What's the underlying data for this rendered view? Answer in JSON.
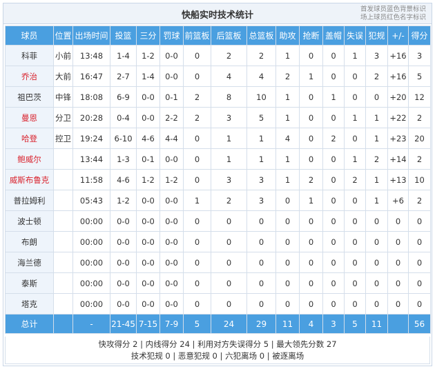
{
  "title": "快船实时技术统计",
  "legend": {
    "line1": "首发球员蓝色背景标识",
    "line2": "场上球员红色名字标识"
  },
  "headers": [
    "球员",
    "位置",
    "出场时间",
    "投篮",
    "三分",
    "罚球",
    "前篮板",
    "后篮板",
    "总篮板",
    "助攻",
    "抢断",
    "盖帽",
    "失误",
    "犯规",
    "+/-",
    "得分"
  ],
  "players": [
    {
      "name": "科菲",
      "on_court": false,
      "cells": [
        "小前",
        "13:48",
        "1-4",
        "1-2",
        "0-0",
        "0",
        "2",
        "2",
        "1",
        "0",
        "0",
        "1",
        "3",
        "+16",
        "3"
      ]
    },
    {
      "name": "乔治",
      "on_court": true,
      "cells": [
        "大前",
        "16:47",
        "2-7",
        "1-4",
        "0-0",
        "0",
        "4",
        "4",
        "2",
        "1",
        "0",
        "0",
        "2",
        "+16",
        "5"
      ]
    },
    {
      "name": "祖巴茨",
      "on_court": false,
      "cells": [
        "中锋",
        "18:08",
        "6-9",
        "0-0",
        "0-1",
        "2",
        "8",
        "10",
        "1",
        "0",
        "1",
        "0",
        "0",
        "+20",
        "12"
      ]
    },
    {
      "name": "曼恩",
      "on_court": true,
      "cells": [
        "分卫",
        "20:28",
        "0-4",
        "0-0",
        "2-2",
        "2",
        "3",
        "5",
        "1",
        "0",
        "0",
        "1",
        "1",
        "+22",
        "2"
      ]
    },
    {
      "name": "哈登",
      "on_court": true,
      "cells": [
        "控卫",
        "19:24",
        "6-10",
        "4-6",
        "4-4",
        "0",
        "1",
        "1",
        "4",
        "0",
        "2",
        "0",
        "1",
        "+23",
        "20"
      ]
    },
    {
      "name": "鲍威尔",
      "on_court": true,
      "cells": [
        "",
        "13:44",
        "1-3",
        "0-1",
        "0-0",
        "0",
        "1",
        "1",
        "1",
        "0",
        "0",
        "1",
        "2",
        "+14",
        "2"
      ]
    },
    {
      "name": "威斯布鲁克",
      "on_court": true,
      "cells": [
        "",
        "11:58",
        "4-6",
        "1-2",
        "1-2",
        "0",
        "3",
        "3",
        "1",
        "2",
        "0",
        "2",
        "1",
        "+13",
        "10"
      ]
    },
    {
      "name": "普拉姆利",
      "on_court": false,
      "cells": [
        "",
        "05:43",
        "1-2",
        "0-0",
        "0-0",
        "1",
        "2",
        "3",
        "0",
        "1",
        "0",
        "0",
        "1",
        "+6",
        "2"
      ]
    },
    {
      "name": "波士顿",
      "on_court": false,
      "cells": [
        "",
        "00:00",
        "0-0",
        "0-0",
        "0-0",
        "0",
        "0",
        "0",
        "0",
        "0",
        "0",
        "0",
        "0",
        "0",
        "0"
      ]
    },
    {
      "name": "布朗",
      "on_court": false,
      "cells": [
        "",
        "00:00",
        "0-0",
        "0-0",
        "0-0",
        "0",
        "0",
        "0",
        "0",
        "0",
        "0",
        "0",
        "0",
        "0",
        "0"
      ]
    },
    {
      "name": "海兰德",
      "on_court": false,
      "cells": [
        "",
        "00:00",
        "0-0",
        "0-0",
        "0-0",
        "0",
        "0",
        "0",
        "0",
        "0",
        "0",
        "0",
        "0",
        "0",
        "0"
      ]
    },
    {
      "name": "泰斯",
      "on_court": false,
      "cells": [
        "",
        "00:00",
        "0-0",
        "0-0",
        "0-0",
        "0",
        "0",
        "0",
        "0",
        "0",
        "0",
        "0",
        "0",
        "0",
        "0"
      ]
    },
    {
      "name": "塔克",
      "on_court": false,
      "cells": [
        "",
        "00:00",
        "0-0",
        "0-0",
        "0-0",
        "0",
        "0",
        "0",
        "0",
        "0",
        "0",
        "0",
        "0",
        "0",
        "0"
      ]
    }
  ],
  "totals": {
    "label": "总计",
    "cells": [
      "",
      "-",
      "21-45",
      "7-15",
      "7-9",
      "5",
      "24",
      "29",
      "11",
      "4",
      "3",
      "5",
      "11",
      "",
      "56"
    ]
  },
  "summary": {
    "line1": "快攻得分 2 | 内线得分 24 | 利用对方失误得分 5 | 最大领先分数 27",
    "line2": "技术犯规 0 | 恶意犯规 0 | 六犯离场 0 | 被逐离场"
  },
  "colors": {
    "header_bg": "#4a9fe0",
    "starter_bg": "#eef4fb",
    "on_court_name": "#d9232e"
  }
}
